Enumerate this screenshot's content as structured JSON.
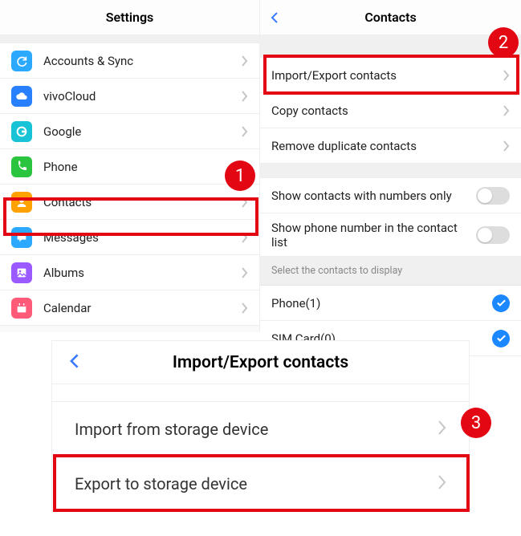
{
  "callouts": {
    "n1": "1",
    "n2": "2",
    "n3": "3"
  },
  "left": {
    "title": "Settings",
    "items": [
      {
        "label": "Accounts & Sync"
      },
      {
        "label": "vivoCloud"
      },
      {
        "label": "Google"
      },
      {
        "label": "Phone"
      },
      {
        "label": "Contacts"
      },
      {
        "label": "Messages"
      },
      {
        "label": "Albums"
      },
      {
        "label": "Calendar"
      }
    ]
  },
  "right": {
    "title": "Contacts",
    "group1": [
      {
        "label": "Import/Export contacts"
      },
      {
        "label": "Copy contacts"
      },
      {
        "label": "Remove duplicate contacts"
      }
    ],
    "group2": [
      {
        "label": "Show contacts with numbers only"
      },
      {
        "label": "Show phone number in the contact list"
      }
    ],
    "section_head": "Select the contacts to display",
    "group3": [
      {
        "label": "Phone(1)"
      },
      {
        "label": "SIM Card(0)"
      }
    ]
  },
  "bottom": {
    "title": "Import/Export contacts",
    "items": [
      {
        "label": "Import from storage device"
      },
      {
        "label": "Export to storage device"
      }
    ]
  }
}
